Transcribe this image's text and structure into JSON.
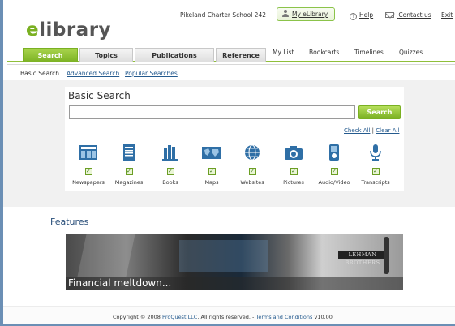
{
  "header": {
    "logo_e": "e",
    "logo_rest": "library",
    "school": "Pikeland Charter School 242",
    "my_elibrary": "My eLibrary",
    "help": "Help",
    "contact": "Contact us",
    "exit": "Exit"
  },
  "nav": {
    "tabs": [
      "Search",
      "Topics",
      "Publications",
      "Reference"
    ],
    "sub": [
      "My List",
      "Bookcarts",
      "Timelines",
      "Quizzes"
    ]
  },
  "breadcrumb": {
    "current": "Basic Search",
    "advanced": "Advanced Search",
    "popular": "Popular Searches"
  },
  "search": {
    "title": "Basic Search",
    "value": "",
    "button": "Search",
    "check_all": "Check All",
    "separator": " | ",
    "clear_all": "Clear All"
  },
  "categories": [
    {
      "label": "Newspapers",
      "icon": "newspaper-icon",
      "checked": true
    },
    {
      "label": "Magazines",
      "icon": "magazine-icon",
      "checked": true
    },
    {
      "label": "Books",
      "icon": "books-icon",
      "checked": true
    },
    {
      "label": "Maps",
      "icon": "map-icon",
      "checked": true
    },
    {
      "label": "Websites",
      "icon": "globe-icon",
      "checked": true
    },
    {
      "label": "Pictures",
      "icon": "camera-icon",
      "checked": true
    },
    {
      "label": "Audio/Video",
      "icon": "media-player-icon",
      "checked": true
    },
    {
      "label": "Transcripts",
      "icon": "microphone-icon",
      "checked": true
    }
  ],
  "features": {
    "title": "Features",
    "caption": "Financial meltdown...",
    "sign_text": "LEHMAN BROTHERS"
  },
  "footer": {
    "prefix": "Copyright © 2008",
    "company": "ProQuest LLC",
    "middle": ". All rights reserved. -",
    "terms": "Terms and Conditions",
    "version": "v10.00"
  },
  "colors": {
    "brand_green": "#7ab022",
    "link_blue": "#245a8e",
    "icon_blue": "#2f6fa6"
  }
}
